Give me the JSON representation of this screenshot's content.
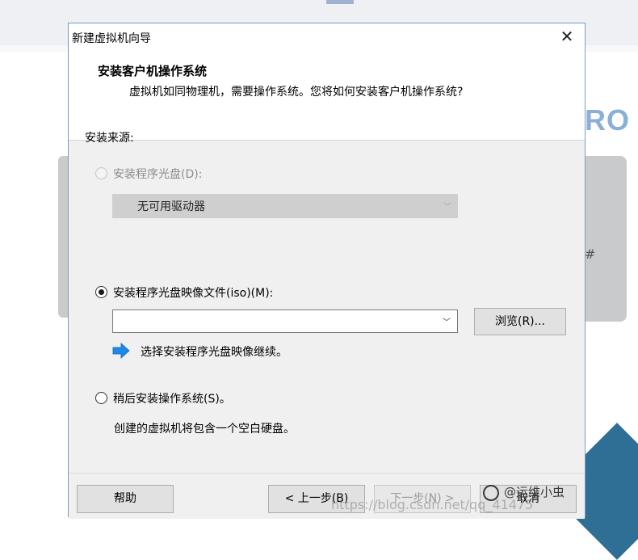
{
  "background": {
    "brand_partial": "RO",
    "card_glyph": "#"
  },
  "dialog": {
    "title": "新建虚拟机向导",
    "close_icon": "close-icon",
    "header": {
      "title": "安装客户机操作系统",
      "subtitle": "虚拟机如同物理机，需要操作系统。您将如何安装客户机操作系统?"
    },
    "install_source_label": "安装来源:",
    "options": {
      "disc": {
        "label": "安装程序光盘(D):",
        "selected": false,
        "enabled": false,
        "drive_value": "无可用驱动器"
      },
      "iso": {
        "label": "安装程序光盘映像文件(iso)(M):",
        "selected": true,
        "enabled": true,
        "value": "",
        "browse_label": "浏览(R)...",
        "hint": "选择安装程序光盘映像继续。",
        "hint_icon": "arrow-right-icon"
      },
      "later": {
        "label": "稍后安装操作系统(S)。",
        "selected": false,
        "description": "创建的虚拟机将包含一个空白硬盘。"
      }
    },
    "footer": {
      "help": "帮助",
      "back": "< 上一步(B)",
      "next": "下一步(N) >",
      "cancel": "取消"
    }
  },
  "watermark": {
    "account": "@运维小虫",
    "url": "https://blog.csdn.net/qq_41475"
  },
  "colors": {
    "hint_arrow": "#1e88e5",
    "dialog_border": "#7a9cc6",
    "brand": "#8ab0d8"
  }
}
